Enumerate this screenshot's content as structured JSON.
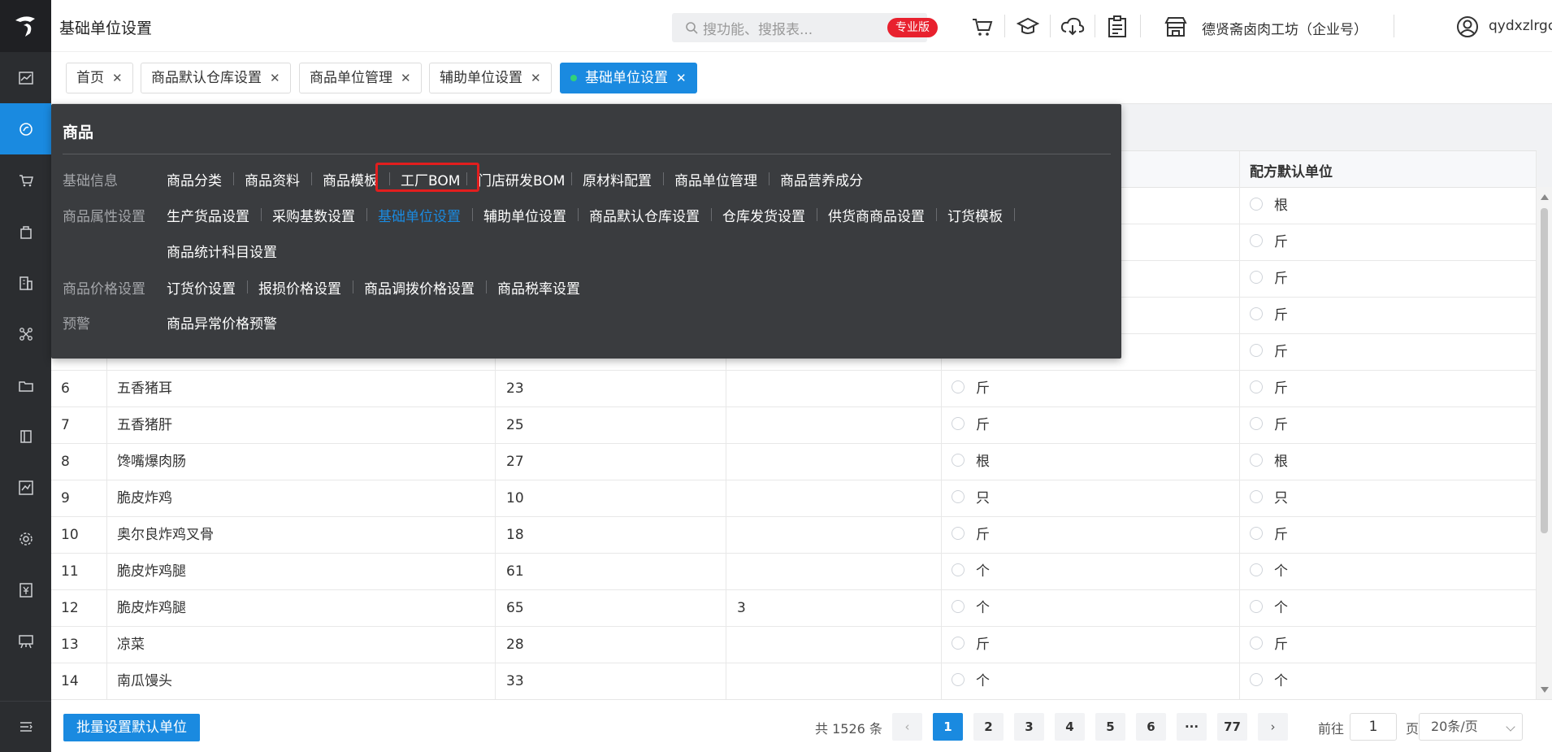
{
  "header": {
    "title": "基础单位设置",
    "search_placeholder": "搜功能、搜报表...",
    "badge": "专业版",
    "store": "德贤斋卤肉工坊（企业号）",
    "user": "qydxzlrgc"
  },
  "tabs": [
    {
      "label": "首页"
    },
    {
      "label": "商品默认仓库设置"
    },
    {
      "label": "商品单位管理"
    },
    {
      "label": "辅助单位设置"
    },
    {
      "label": "基础单位设置"
    }
  ],
  "table": {
    "header_last": "配方默认单位",
    "rows": [
      {
        "no": "",
        "name": "",
        "code": "",
        "aux": "",
        "base": "",
        "formula": "根"
      },
      {
        "no": "",
        "name": "",
        "code": "",
        "aux": "",
        "base": "",
        "formula": "斤"
      },
      {
        "no": "",
        "name": "",
        "code": "",
        "aux": "",
        "base": "",
        "formula": "斤"
      },
      {
        "no": "",
        "name": "",
        "code": "",
        "aux": "",
        "base": "",
        "formula": "斤"
      },
      {
        "no": "",
        "name": "",
        "code": "",
        "aux": "",
        "base": "",
        "formula": "斤"
      },
      {
        "no": "6",
        "name": "五香猪耳",
        "code": "23",
        "aux": "",
        "base": "斤",
        "formula": "斤"
      },
      {
        "no": "7",
        "name": "五香猪肝",
        "code": "25",
        "aux": "",
        "base": "斤",
        "formula": "斤"
      },
      {
        "no": "8",
        "name": "馋嘴爆肉肠",
        "code": "27",
        "aux": "",
        "base": "根",
        "formula": "根"
      },
      {
        "no": "9",
        "name": "脆皮炸鸡",
        "code": "10",
        "aux": "",
        "base": "只",
        "formula": "只"
      },
      {
        "no": "10",
        "name": "奥尔良炸鸡叉骨",
        "code": "18",
        "aux": "",
        "base": "斤",
        "formula": "斤"
      },
      {
        "no": "11",
        "name": "脆皮炸鸡腿",
        "code": "61",
        "aux": "",
        "base": "个",
        "formula": "个"
      },
      {
        "no": "12",
        "name": "脆皮炸鸡腿",
        "code": "65",
        "aux": "3",
        "base": "个",
        "formula": "个"
      },
      {
        "no": "13",
        "name": "凉菜",
        "code": "28",
        "aux": "",
        "base": "斤",
        "formula": "斤"
      },
      {
        "no": "14",
        "name": "南瓜馒头",
        "code": "33",
        "aux": "",
        "base": "个",
        "formula": "个"
      }
    ]
  },
  "footer": {
    "batch_button": "批量设置默认单位",
    "total": "共 1526 条",
    "pages": [
      "1",
      "2",
      "3",
      "4",
      "5",
      "6",
      "···",
      "77"
    ],
    "goto_label": "前往",
    "goto_value": "1",
    "page_label": "页",
    "page_size": "20条/页"
  },
  "menu": {
    "title": "商品",
    "groups": [
      {
        "label": "基础信息",
        "items": [
          "商品分类",
          "商品资料",
          "商品模板",
          "工厂BOM",
          "门店研发BOM",
          "原材料配置",
          "商品单位管理",
          "商品营养成分"
        ]
      },
      {
        "label": "商品属性设置",
        "items": [
          "生产货品设置",
          "采购基数设置",
          "基础单位设置",
          "辅助单位设置",
          "商品默认仓库设置",
          "仓库发货设置",
          "供货商商品设置",
          "订货模板"
        ],
        "items_wrap": [
          "商品统计科目设置"
        ]
      },
      {
        "label": "商品价格设置",
        "items": [
          "订货价设置",
          "报损价格设置",
          "商品调拨价格设置",
          "商品税率设置"
        ]
      },
      {
        "label": "预警",
        "items": [
          "商品异常价格预警"
        ]
      }
    ]
  },
  "colors": {
    "accent": "#1a8ae0",
    "sidebar": "#2b2d30",
    "menu_bg": "#3a3c3f",
    "highlight": "#e21e1e",
    "badge": "#e8212e"
  }
}
